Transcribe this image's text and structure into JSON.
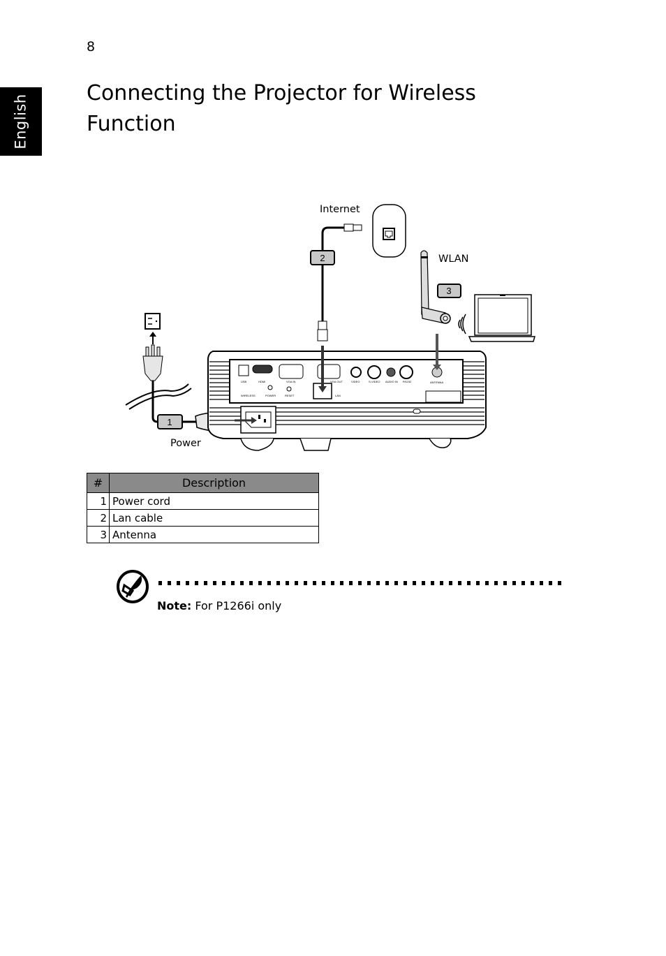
{
  "page": {
    "number": "8",
    "language_tab": "English",
    "title": "Connecting the Projector for Wireless Function"
  },
  "diagram": {
    "labels": {
      "internet": "Internet",
      "wlan": "WLAN",
      "power": "Power"
    },
    "callouts": [
      "1",
      "2",
      "3"
    ],
    "ports": [
      "USB",
      "HDMI",
      "VGA IN",
      "VGA OUT",
      "VIDEO",
      "S-VIDEO",
      "AUDIO IN",
      "RS232",
      "ANTENNA",
      "WIRELESS",
      "POWER",
      "RESET",
      "LAN"
    ]
  },
  "table": {
    "headers": [
      "#",
      "Description"
    ],
    "rows": [
      {
        "num": "1",
        "desc": "Power cord"
      },
      {
        "num": "2",
        "desc": "Lan cable"
      },
      {
        "num": "3",
        "desc": "Antenna"
      }
    ]
  },
  "note": {
    "label": "Note:",
    "text": " For P1266i only"
  }
}
